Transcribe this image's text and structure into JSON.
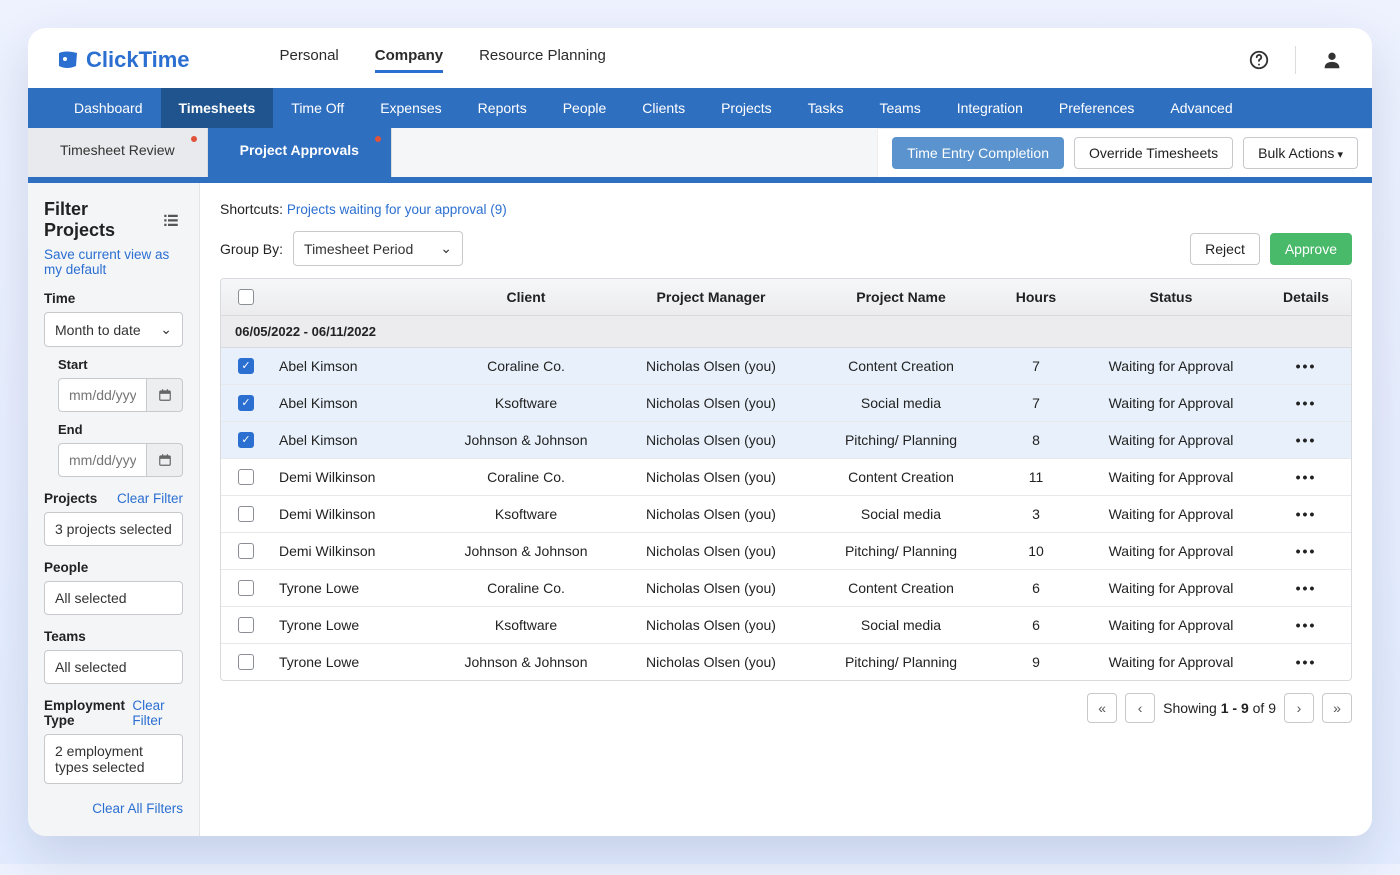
{
  "brand": "ClickTime",
  "topnav": {
    "items": [
      "Personal",
      "Company",
      "Resource Planning"
    ],
    "active": "Company"
  },
  "subnav": {
    "items": [
      "Dashboard",
      "Timesheets",
      "Time Off",
      "Expenses",
      "Reports",
      "People",
      "Clients",
      "Projects",
      "Tasks",
      "Teams",
      "Integration",
      "Preferences",
      "Advanced"
    ],
    "active": "Timesheets"
  },
  "tabs": {
    "items": [
      {
        "label": "Timesheet Review",
        "dot": true
      },
      {
        "label": "Project Approvals",
        "dot": true
      }
    ],
    "active": "Project Approvals"
  },
  "tabbar_actions": {
    "time_entry": "Time Entry Completion",
    "override": "Override Timesheets",
    "bulk": "Bulk Actions"
  },
  "sidebar": {
    "title": "Filter Projects",
    "save_view": "Save current view as my default",
    "time_label": "Time",
    "time_select": "Month to date",
    "start_label": "Start",
    "end_label": "End",
    "date_placeholder": "mm/dd/yyyy",
    "projects_label": "Projects",
    "projects_value": "3 projects selected",
    "people_label": "People",
    "people_value": "All selected",
    "teams_label": "Teams",
    "teams_value": "All selected",
    "emp_label": "Employment Type",
    "emp_value": "2 employment types selected",
    "clear_filter": "Clear Filter",
    "clear_all": "Clear All Filters"
  },
  "content": {
    "shortcuts_prefix": "Shortcuts: ",
    "shortcuts_link": "Projects waiting for your approval (9)",
    "groupby_label": "Group By:",
    "groupby_value": "Timesheet Period",
    "reject": "Reject",
    "approve": "Approve"
  },
  "table": {
    "headers": {
      "client": "Client",
      "pm": "Project Manager",
      "proj": "Project Name",
      "hours": "Hours",
      "status": "Status",
      "details": "Details"
    },
    "group": "06/05/2022 - 06/11/2022",
    "rows": [
      {
        "sel": true,
        "person": "Abel Kimson",
        "client": "Coraline Co.",
        "pm": "Nicholas Olsen (you)",
        "proj": "Content Creation",
        "hours": "7",
        "status": "Waiting for Approval"
      },
      {
        "sel": true,
        "person": "Abel Kimson",
        "client": "Ksoftware",
        "pm": "Nicholas Olsen (you)",
        "proj": "Social media",
        "hours": "7",
        "status": "Waiting for Approval"
      },
      {
        "sel": true,
        "person": "Abel Kimson",
        "client": "Johnson & Johnson",
        "pm": "Nicholas Olsen (you)",
        "proj": "Pitching/ Planning",
        "hours": "8",
        "status": "Waiting for Approval"
      },
      {
        "sel": false,
        "person": "Demi Wilkinson",
        "client": "Coraline Co.",
        "pm": "Nicholas Olsen (you)",
        "proj": "Content Creation",
        "hours": "11",
        "status": "Waiting for Approval"
      },
      {
        "sel": false,
        "person": "Demi Wilkinson",
        "client": "Ksoftware",
        "pm": "Nicholas Olsen (you)",
        "proj": "Social media",
        "hours": "3",
        "status": "Waiting for Approval"
      },
      {
        "sel": false,
        "person": "Demi Wilkinson",
        "client": "Johnson & Johnson",
        "pm": "Nicholas Olsen (you)",
        "proj": "Pitching/ Planning",
        "hours": "10",
        "status": "Waiting for Approval"
      },
      {
        "sel": false,
        "person": "Tyrone Lowe",
        "client": "Coraline Co.",
        "pm": "Nicholas Olsen (you)",
        "proj": "Content Creation",
        "hours": "6",
        "status": "Waiting for Approval"
      },
      {
        "sel": false,
        "person": "Tyrone Lowe",
        "client": "Ksoftware",
        "pm": "Nicholas Olsen (you)",
        "proj": "Social media",
        "hours": "6",
        "status": "Waiting for Approval"
      },
      {
        "sel": false,
        "person": "Tyrone Lowe",
        "client": "Johnson & Johnson",
        "pm": "Nicholas Olsen (you)",
        "proj": "Pitching/ Planning",
        "hours": "9",
        "status": "Waiting for Approval"
      }
    ]
  },
  "pager": {
    "text_prefix": "Showing ",
    "range": "1 - 9",
    "of": " of ",
    "total": "9"
  }
}
